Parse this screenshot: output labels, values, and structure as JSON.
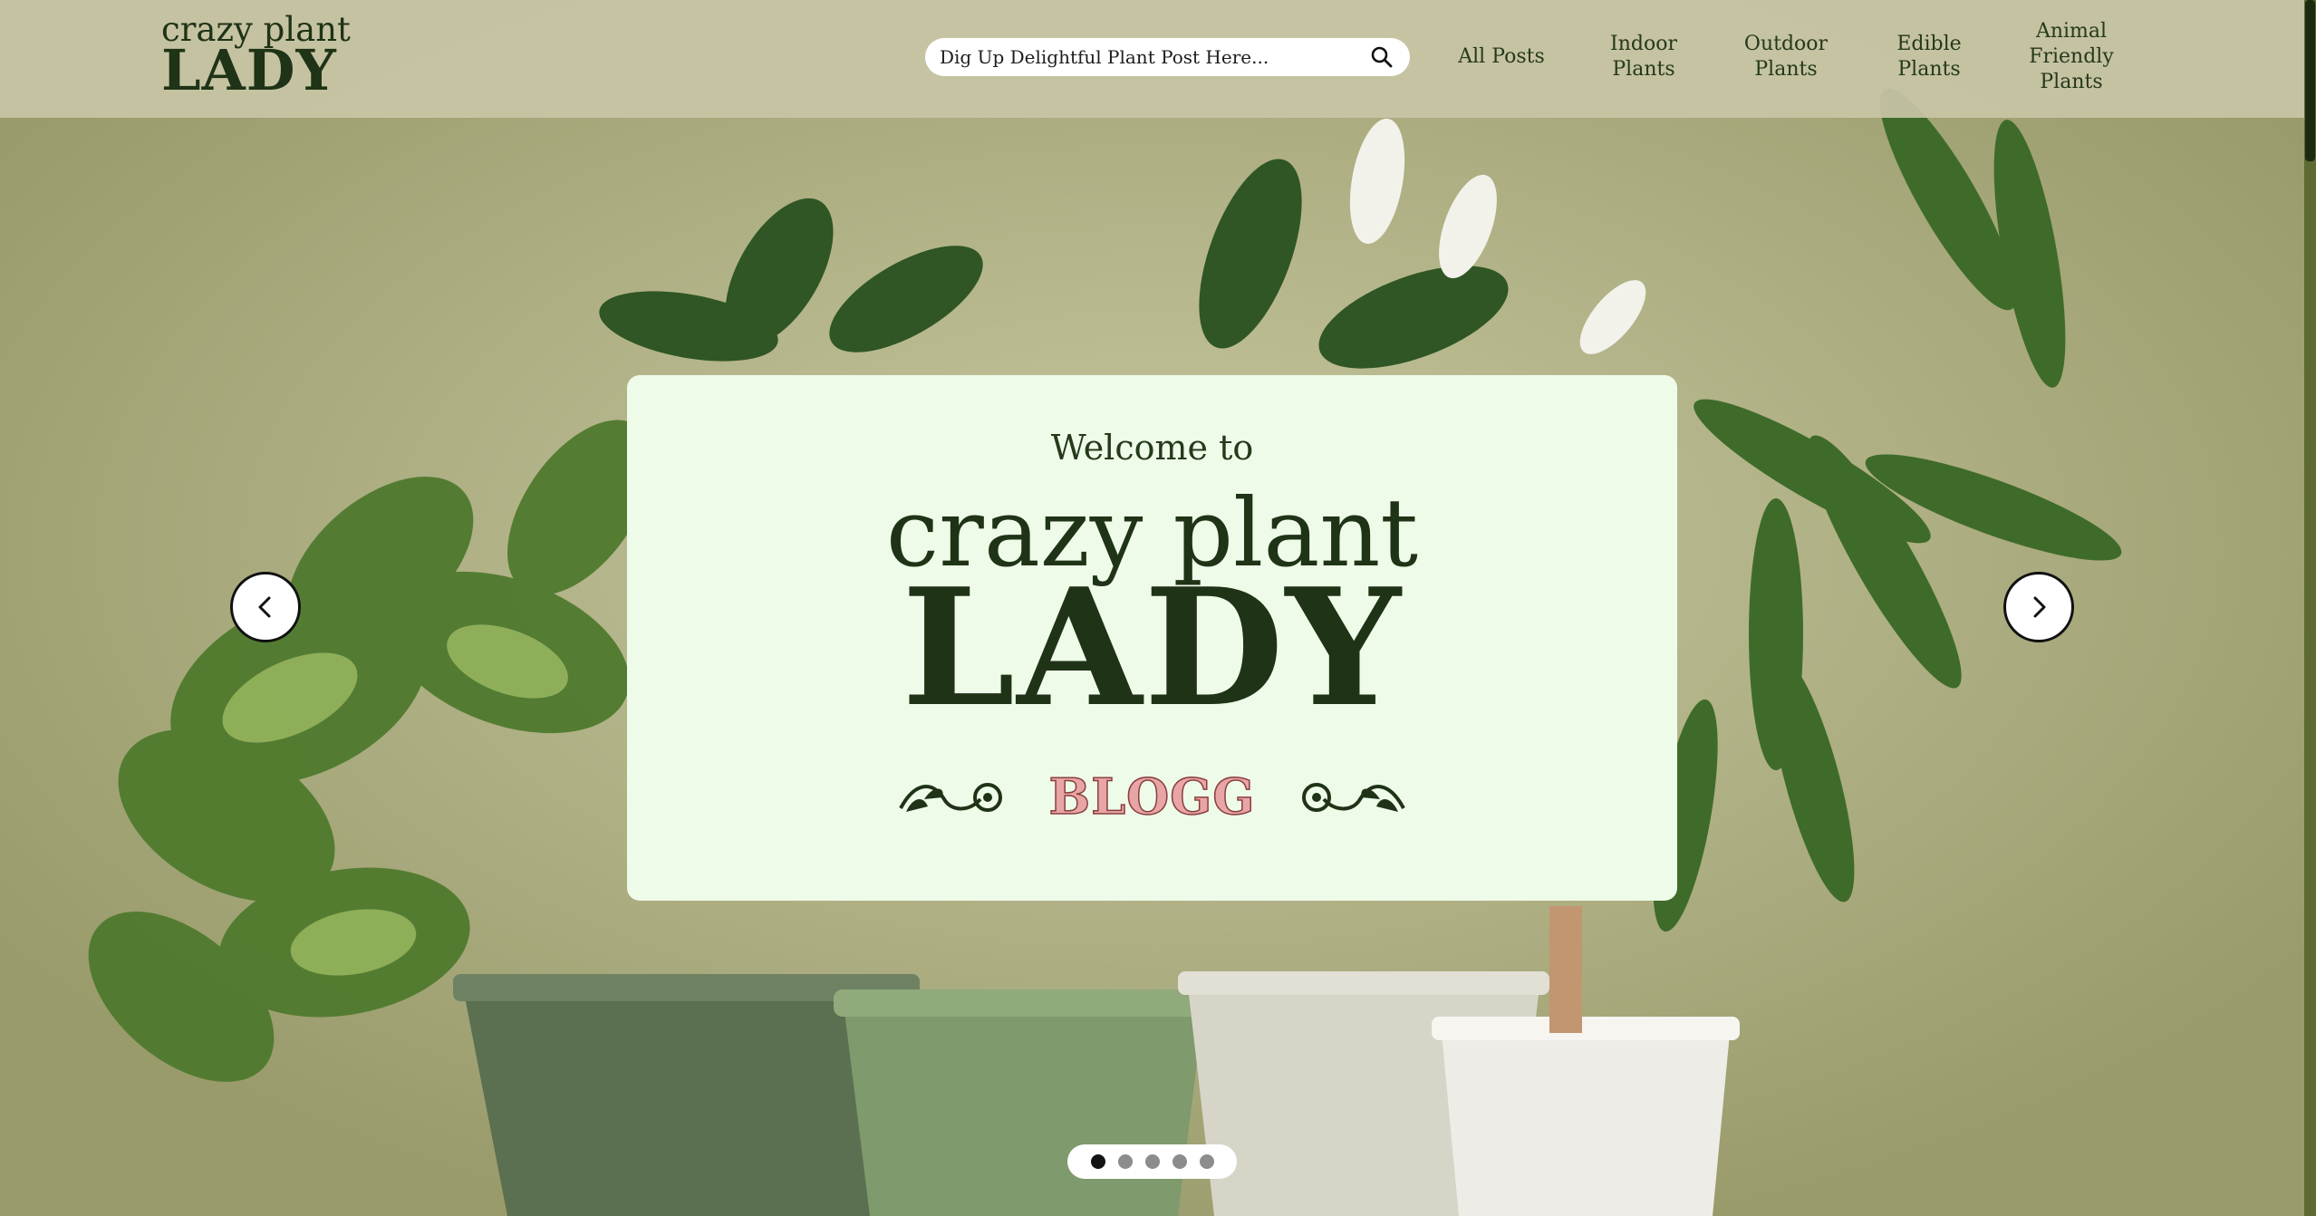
{
  "header": {
    "logo_top": "crazy plant",
    "logo_bottom": "LADY",
    "search_placeholder": "Dig Up Delightful Plant Post Here...",
    "nav": [
      {
        "label": "All Posts"
      },
      {
        "label": "Indoor\nPlants"
      },
      {
        "label": "Outdoor\nPlants"
      },
      {
        "label": "Edible\nPlants"
      },
      {
        "label": "Animal\nFriendly\nPlants"
      }
    ]
  },
  "hero": {
    "welcome": "Welcome to",
    "brand_top": "crazy plant",
    "brand_bottom": "LADY",
    "tagline": "BLOGG"
  },
  "carousel": {
    "slide_count": 5,
    "active_index": 0
  },
  "colors": {
    "brand_green": "#1f3316",
    "card_background": "#eefbe9",
    "tagline_pink": "#e8a5a5",
    "header_background": "#c8c5a6"
  },
  "icons": {
    "search": "magnifier-icon",
    "prev": "chevron-left-icon",
    "next": "chevron-right-icon"
  }
}
